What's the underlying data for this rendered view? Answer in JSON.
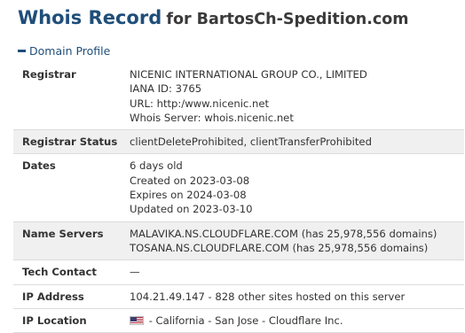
{
  "header": {
    "title": "Whois Record",
    "subtitle": "for BartosCh-Spedition.com"
  },
  "section": {
    "label": "Domain Profile",
    "icon": "minus-icon"
  },
  "rows": {
    "registrar": {
      "label": "Registrar",
      "lines": [
        "NICENIC INTERNATIONAL GROUP CO., LIMITED",
        "IANA ID: 3765",
        "URL: http:/www.nicenic.net",
        "Whois Server: whois.nicenic.net"
      ]
    },
    "registrar_status": {
      "label": "Registrar Status",
      "value": "clientDeleteProhibited, clientTransferProhibited"
    },
    "dates": {
      "label": "Dates",
      "lines": [
        "6 days old",
        "Created on 2023-03-08",
        "Expires on 2024-03-08",
        "Updated on 2023-03-10"
      ]
    },
    "name_servers": {
      "label": "Name Servers",
      "lines": [
        "MALAVIKA.NS.CLOUDFLARE.COM (has 25,978,556 domains)",
        "TOSANA.NS.CLOUDFLARE.COM (has 25,978,556 domains)"
      ]
    },
    "tech_contact": {
      "label": "Tech Contact",
      "value": "—"
    },
    "ip_address": {
      "label": "IP Address",
      "value": "104.21.49.147 - 828 other sites hosted on this server"
    },
    "ip_location": {
      "label": "IP Location",
      "flag": "us-flag-icon",
      "value": "- California - San Jose - Cloudflare Inc."
    }
  }
}
